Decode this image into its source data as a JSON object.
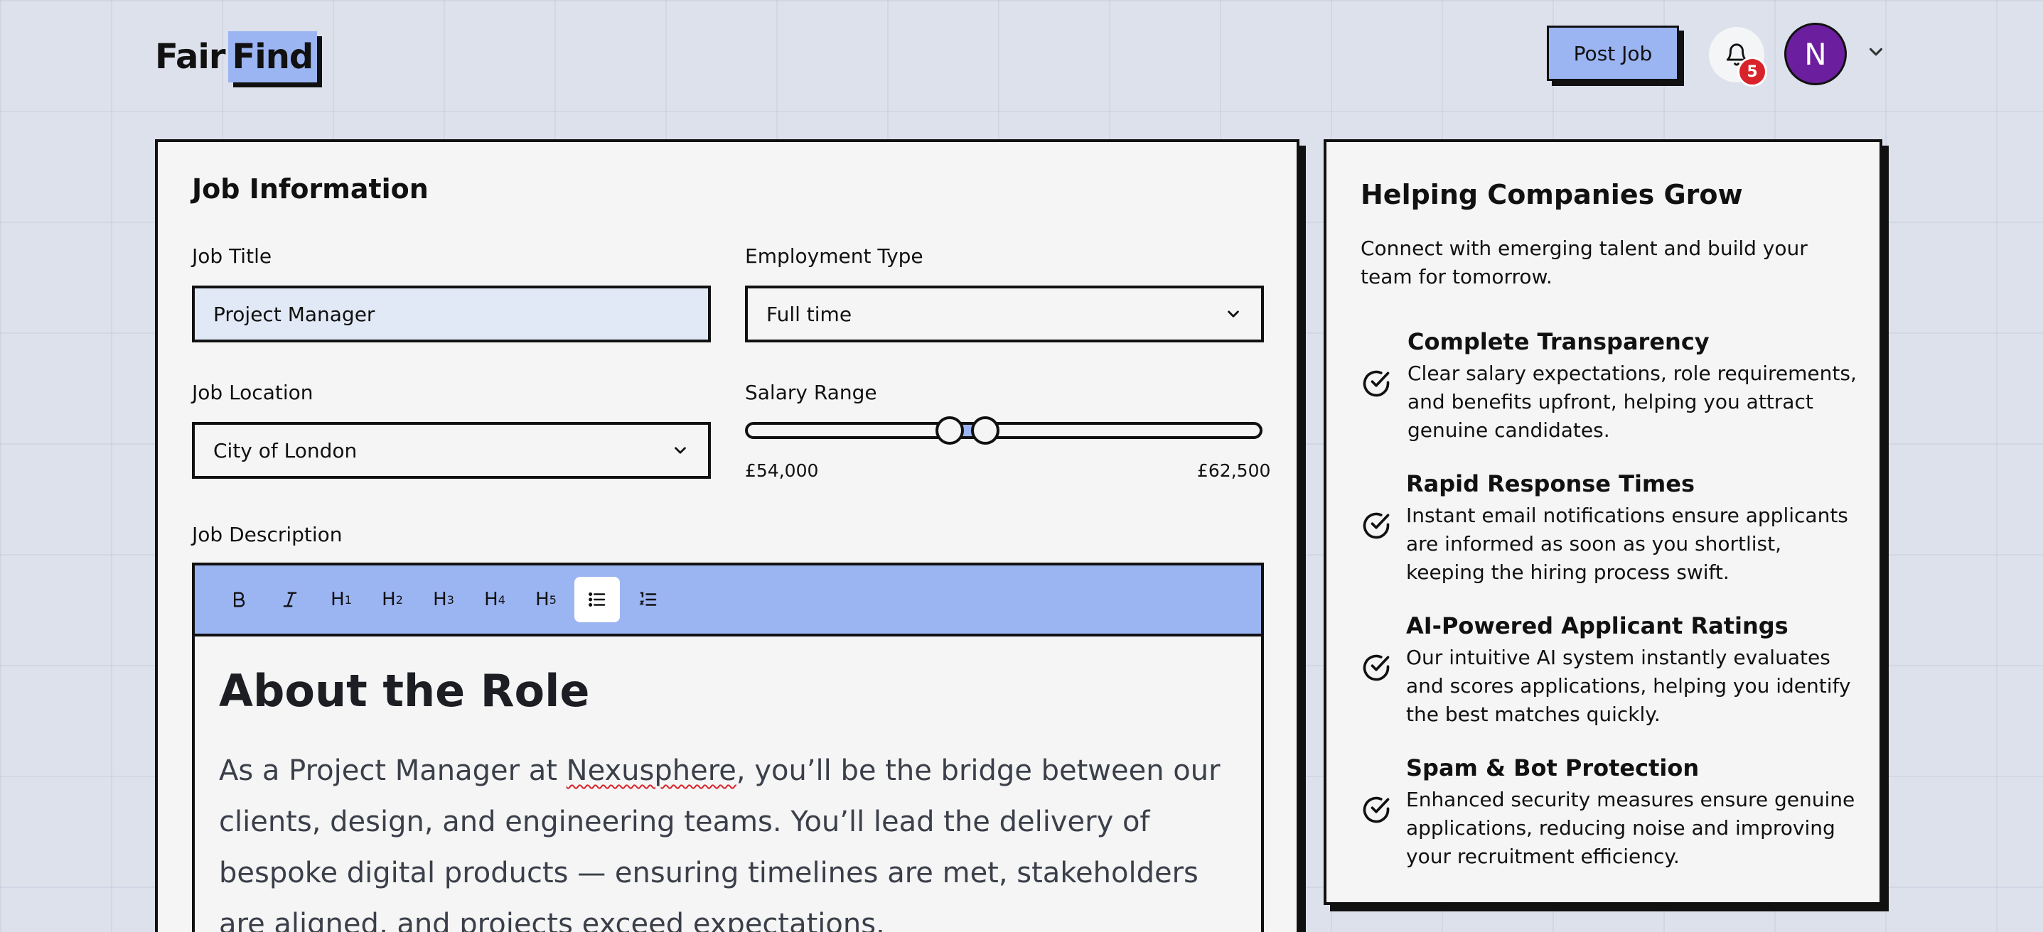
{
  "brand": {
    "part1": "Fair",
    "part2": "Find"
  },
  "header": {
    "post_job_label": "Post Job",
    "notification_count": "5",
    "avatar_initial": "N"
  },
  "form": {
    "title": "Job Information",
    "job_title_label": "Job Title",
    "job_title_value": "Project Manager",
    "employment_type_label": "Employment Type",
    "employment_type_value": "Full time",
    "location_label": "Job Location",
    "location_value": "City of London",
    "salary_label": "Salary Range",
    "salary_min": "£54,000",
    "salary_max": "£62,500",
    "description_label": "Job Description",
    "toolbar": {
      "bold": "B",
      "italic": "I",
      "h1": "H",
      "h2": "H",
      "h3": "H",
      "h4": "H",
      "h5": "H",
      "h1_n": "1",
      "h2_n": "2",
      "h3_n": "3",
      "h4_n": "4",
      "h5_n": "5"
    },
    "editor_heading": "About the Role",
    "editor_para_before": "As a Project Manager at ",
    "editor_para_link": "Nexusphere",
    "editor_para_after": ", you’ll be the bridge between our clients, design, and engineering teams. You’ll lead the delivery of bespoke digital products — ensuring timelines are met, stakeholders are aligned, and projects exceed expectations."
  },
  "panel": {
    "title": "Helping Companies Grow",
    "subtitle": "Connect with emerging talent and build your team for tomorrow.",
    "features": [
      {
        "title": "Complete Transparency",
        "desc": "Clear salary expectations, role requirements, and benefits upfront, helping you attract genuine candidates."
      },
      {
        "title": "Rapid Response Times",
        "desc": "Instant email notifications ensure applicants are informed as soon as you shortlist, keeping the hiring process swift."
      },
      {
        "title": "AI-Powered Applicant Ratings",
        "desc": "Our intuitive AI system instantly evaluates and scores applications, helping you identify the best matches quickly."
      },
      {
        "title": "Spam & Bot Protection",
        "desc": "Enhanced security measures ensure genuine applications, reducing noise and improving your recruitment efficiency."
      }
    ]
  },
  "colors": {
    "accent": "#9bb4f2",
    "background": "#dde1ec",
    "badge": "#d8232a",
    "avatar": "#6b1e9e"
  }
}
